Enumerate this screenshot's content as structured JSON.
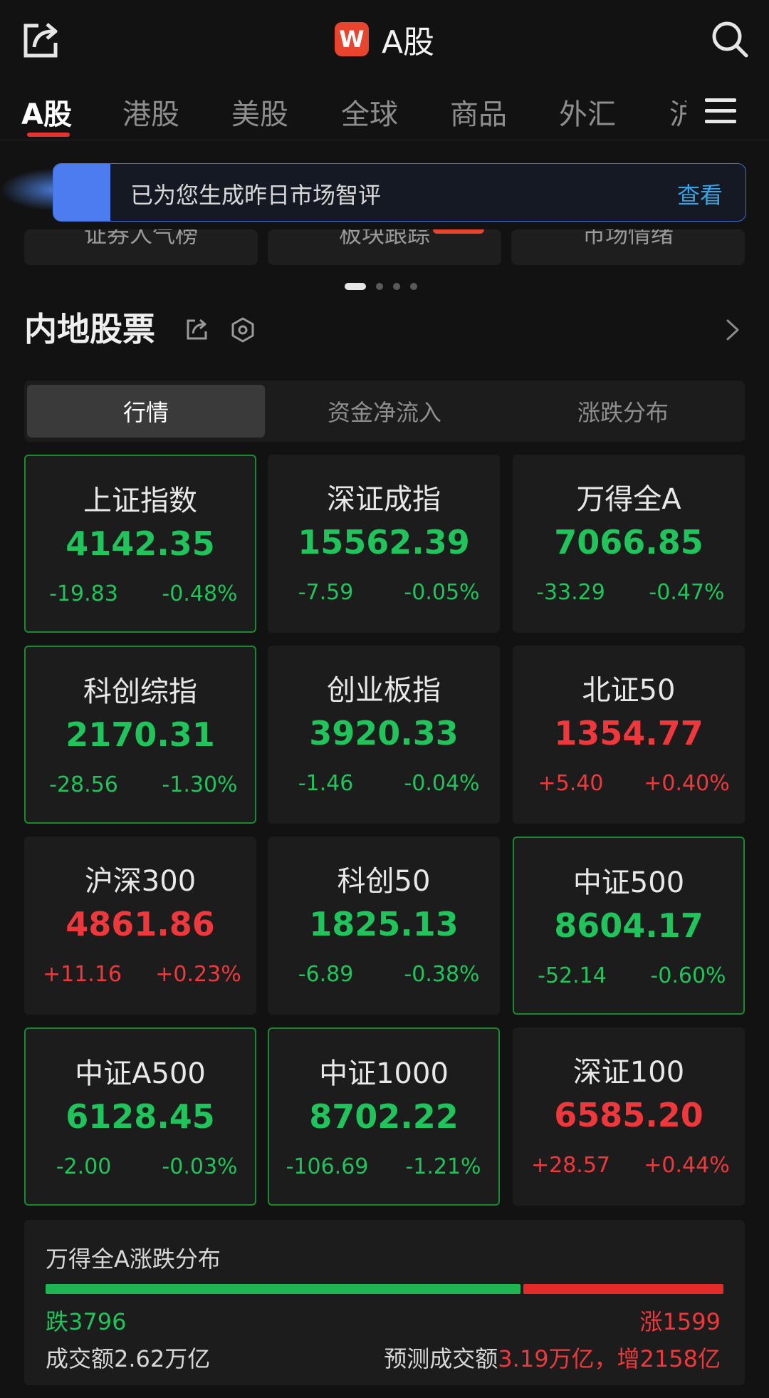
{
  "header": {
    "title": "A股",
    "logo_text": "W",
    "share_icon": "share-icon",
    "search_icon": "search-icon"
  },
  "market_tabs": [
    {
      "label": "A股",
      "active": true
    },
    {
      "label": "港股",
      "active": false
    },
    {
      "label": "美股",
      "active": false
    },
    {
      "label": "全球",
      "active": false
    },
    {
      "label": "商品",
      "active": false
    },
    {
      "label": "外汇",
      "active": false
    }
  ],
  "market_tab_cut": "沪",
  "banner": {
    "text": "已为您生成昨日市场智评",
    "link": "查看"
  },
  "quick_entries": [
    "证券人气榜",
    "板块跟踪",
    "市场情绪"
  ],
  "carousel": {
    "pages": 4,
    "current": 1
  },
  "section": {
    "title": "内地股票"
  },
  "segment": [
    {
      "label": "行情",
      "active": true
    },
    {
      "label": "资金净流入",
      "active": false
    },
    {
      "label": "涨跌分布",
      "active": false
    }
  ],
  "indices": [
    {
      "name": "上证指数",
      "price": "4142.35",
      "change": "-19.83",
      "pct": "-0.48%",
      "dir": "down",
      "highlight": true
    },
    {
      "name": "深证成指",
      "price": "15562.39",
      "change": "-7.59",
      "pct": "-0.05%",
      "dir": "down",
      "highlight": false
    },
    {
      "name": "万得全A",
      "price": "7066.85",
      "change": "-33.29",
      "pct": "-0.47%",
      "dir": "down",
      "highlight": false
    },
    {
      "name": "科创综指",
      "price": "2170.31",
      "change": "-28.56",
      "pct": "-1.30%",
      "dir": "down",
      "highlight": true
    },
    {
      "name": "创业板指",
      "price": "3920.33",
      "change": "-1.46",
      "pct": "-0.04%",
      "dir": "down",
      "highlight": false
    },
    {
      "name": "北证50",
      "price": "1354.77",
      "change": "+5.40",
      "pct": "+0.40%",
      "dir": "up",
      "highlight": false
    },
    {
      "name": "沪深300",
      "price": "4861.86",
      "change": "+11.16",
      "pct": "+0.23%",
      "dir": "up",
      "highlight": false
    },
    {
      "name": "科创50",
      "price": "1825.13",
      "change": "-6.89",
      "pct": "-0.38%",
      "dir": "down",
      "highlight": false
    },
    {
      "name": "中证500",
      "price": "8604.17",
      "change": "-52.14",
      "pct": "-0.60%",
      "dir": "down",
      "highlight": true
    },
    {
      "name": "中证A500",
      "price": "6128.45",
      "change": "-2.00",
      "pct": "-0.03%",
      "dir": "down",
      "highlight": true
    },
    {
      "name": "中证1000",
      "price": "8702.22",
      "change": "-106.69",
      "pct": "-1.21%",
      "dir": "down",
      "highlight": true
    },
    {
      "name": "深证100",
      "price": "6585.20",
      "change": "+28.57",
      "pct": "+0.44%",
      "dir": "up",
      "highlight": false
    }
  ],
  "breadth": {
    "title": "万得全A涨跌分布",
    "down_label": "跌3796",
    "up_label": "涨1599",
    "down_count": 3796,
    "up_count": 1599,
    "volume": "成交额2.62万亿",
    "predicted_prefix": "预测成交额",
    "predicted_value": "3.19万亿，增2158亿"
  },
  "colors": {
    "up": "#f0383c",
    "down": "#1fc45a",
    "accent": "#e73232",
    "link": "#3aa3e6"
  }
}
